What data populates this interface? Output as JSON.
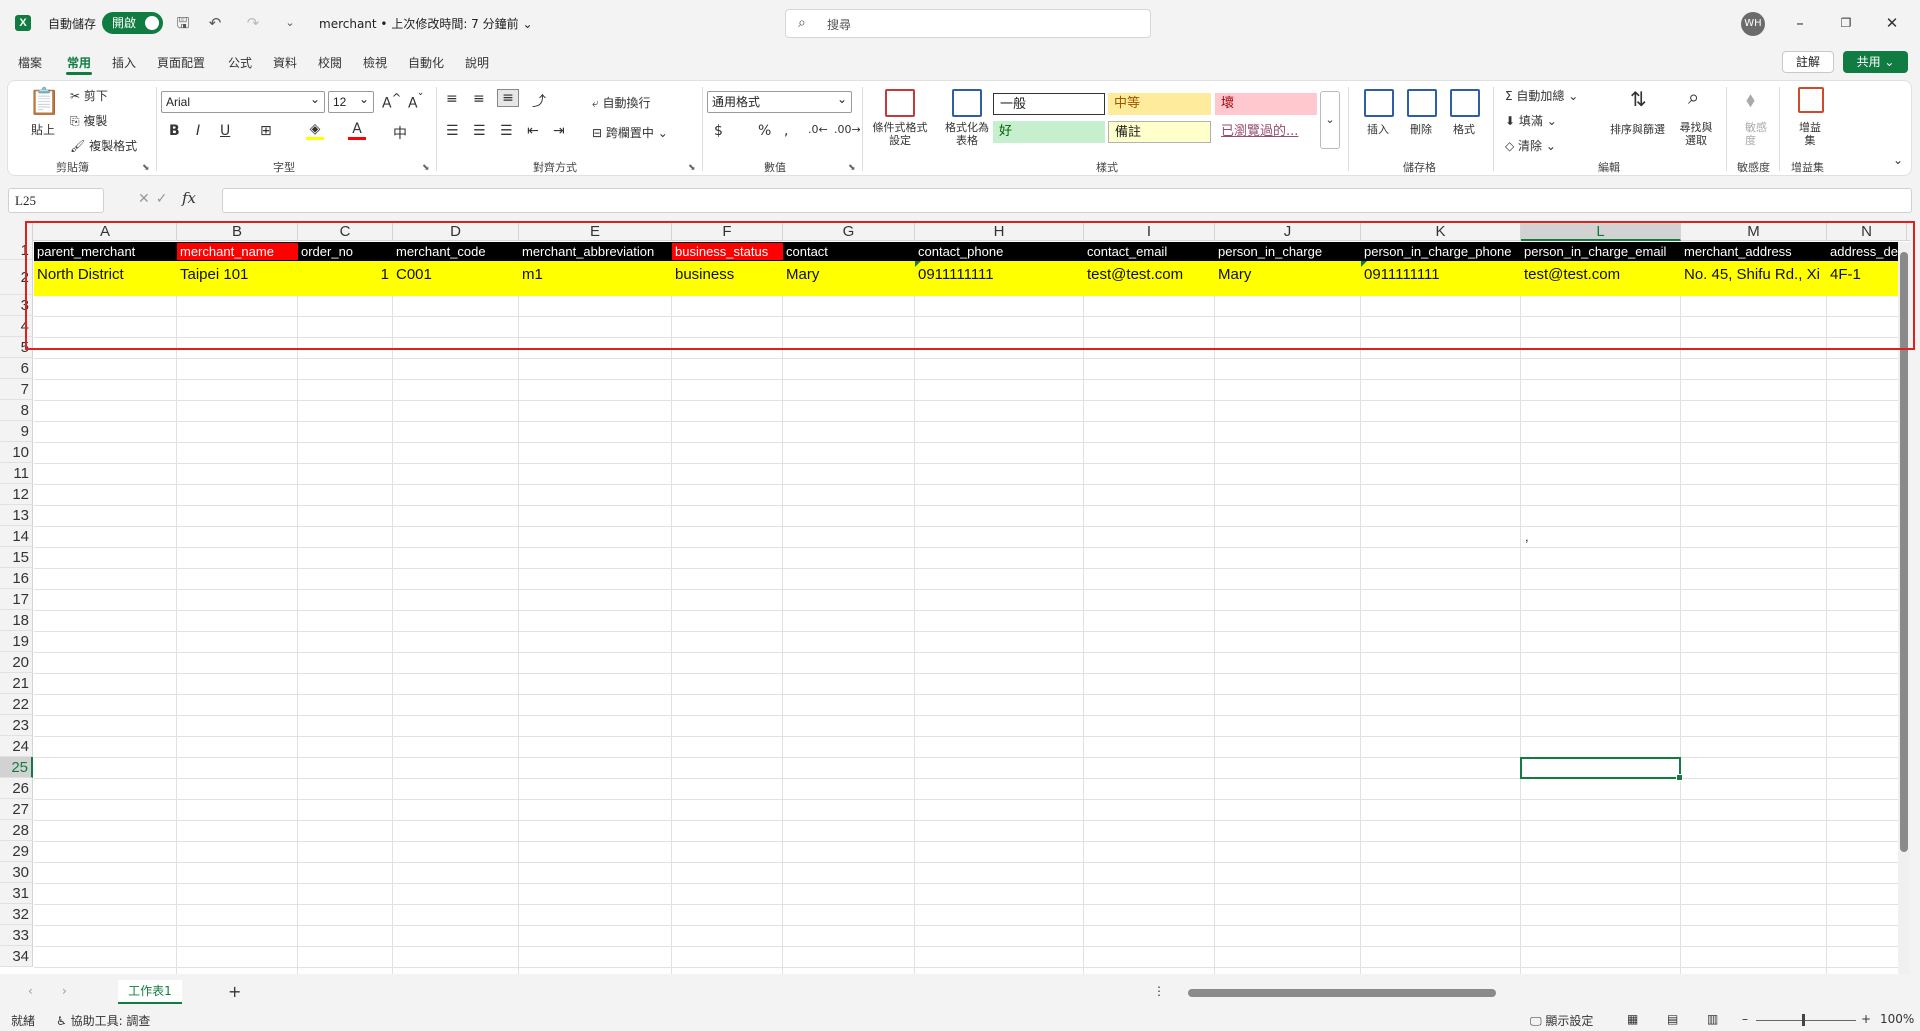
{
  "titlebar": {
    "autosave_label": "自動儲存",
    "autosave_state": "開啟",
    "doc_title": "merchant • 上次修改時間: 7 分鐘前 ⌄",
    "search_placeholder": "搜尋",
    "avatar": "WH",
    "minimize": "–",
    "restore": "❐",
    "close": "✕"
  },
  "ribbon_tabs": [
    "檔案",
    "常用",
    "插入",
    "頁面配置",
    "公式",
    "資料",
    "校閱",
    "檢視",
    "自動化",
    "說明"
  ],
  "ribbon_right": {
    "notes": "註解",
    "share": "共用 ⌄"
  },
  "clipboard": {
    "paste": "貼上",
    "cut": "剪下",
    "copy": "複製",
    "format_painter": "複製格式",
    "group": "剪貼簿"
  },
  "font": {
    "name": "Arial",
    "size": "12",
    "group": "字型"
  },
  "alignment": {
    "wrap": "自動換行",
    "merge": "跨欄置中",
    "group": "對齊方式"
  },
  "number": {
    "format": "通用格式",
    "group": "數值"
  },
  "styles": {
    "conditional": "條件式格式設定",
    "table": "格式化為表格",
    "normal": "一般",
    "neutral": "中等",
    "bad": "壞",
    "good": "好",
    "note": "備註",
    "visited": "已瀏覽過的...",
    "group": "樣式"
  },
  "cells_group": {
    "insert": "插入",
    "delete": "刪除",
    "format": "格式",
    "group": "儲存格"
  },
  "editing": {
    "autosum": "自動加總",
    "fill": "填滿",
    "clear": "清除",
    "sort": "排序與篩選",
    "find": "尋找與選取",
    "group": "編輯"
  },
  "sensitivity": {
    "label": "敏感度",
    "group": "敏感度"
  },
  "addins": {
    "label": "增益集",
    "group": "增益集"
  },
  "colors": {
    "accent": "#107c41",
    "highlight": "#ffff00",
    "header_bg": "#000000",
    "header_red": "#ff0000",
    "annotation": "#e02020"
  },
  "namebox": "L25",
  "columns": [
    "A",
    "B",
    "C",
    "D",
    "E",
    "F",
    "G",
    "H",
    "I",
    "J",
    "K",
    "L",
    "M",
    "N"
  ],
  "selected_column": "L",
  "selected_row": "25",
  "rows": [
    "1",
    "2",
    "3",
    "4",
    "5",
    "6",
    "7",
    "8",
    "9",
    "10",
    "11",
    "12",
    "13",
    "14",
    "15",
    "16",
    "17",
    "18",
    "19",
    "20",
    "21",
    "22",
    "23",
    "24",
    "25",
    "26",
    "27",
    "28",
    "29",
    "30",
    "31",
    "32",
    "33",
    "34"
  ],
  "header_row": [
    "parent_merchant",
    "merchant_name",
    "order_no",
    "merchant_code",
    "merchant_abbreviation",
    "business_status",
    "contact",
    "contact_phone",
    "contact_email",
    "person_in_charge",
    "person_in_charge_phone",
    "person_in_charge_email",
    "merchant_address",
    "address_de"
  ],
  "data_row": [
    "North District",
    "Taipei 101",
    "1",
    "C001",
    "m1",
    "business",
    "Mary",
    "0911111111",
    "test@test.com",
    "Mary",
    "0911111111",
    "test@test.com",
    "No. 45, Shifu Rd., Xi",
    "4F-1"
  ],
  "stray_mark": ",",
  "sheet": {
    "name": "工作表1",
    "add": "+"
  },
  "status": {
    "ready": "就緒",
    "accessibility": "協助工具: 調查",
    "display": "顯示設定",
    "zoom": "100%"
  }
}
